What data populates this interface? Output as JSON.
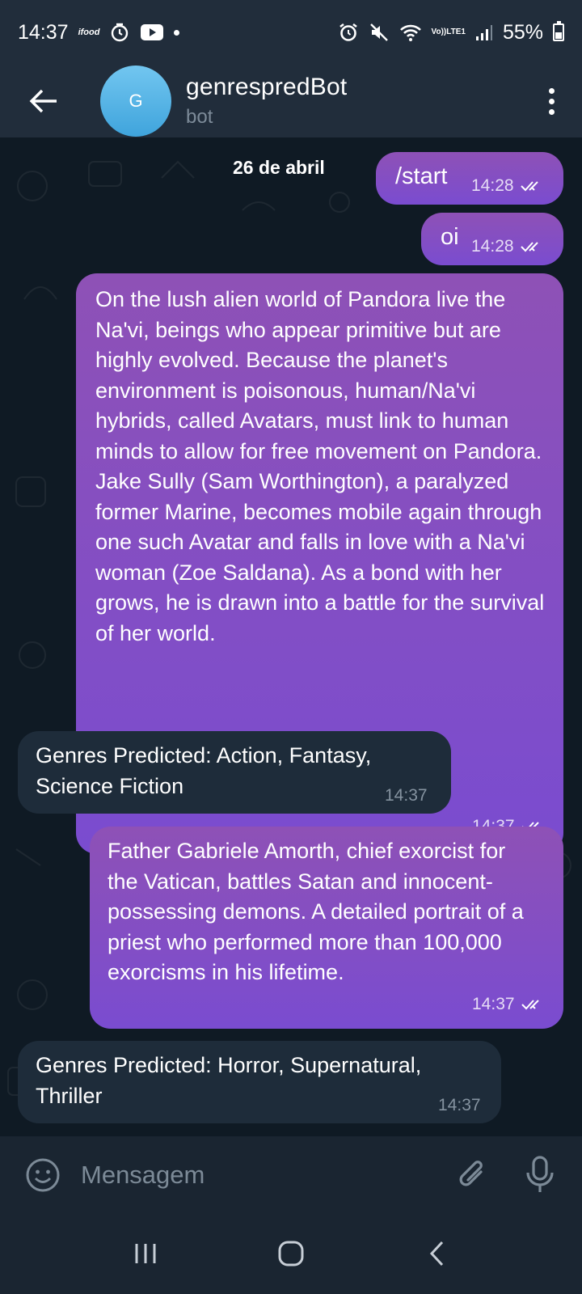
{
  "status_bar": {
    "time": "14:37",
    "ifood_label": "ifood",
    "volte_label": "Vo))",
    "lte_label": "LTE1",
    "battery": "55%",
    "icons": [
      "ifood-icon",
      "timer-icon",
      "youtube-icon",
      "notification-dot",
      "alarm-icon",
      "mute-icon",
      "wifi-icon",
      "volte-icon",
      "signal-icon",
      "battery-icon"
    ]
  },
  "header": {
    "avatar_letter": "G",
    "title": "genrespredBot",
    "subtitle": "bot",
    "avatar_color": "#4eaee3"
  },
  "chat": {
    "date": "26 de abril",
    "messages": [
      {
        "direction": "out",
        "text": "/start",
        "time": "14:28",
        "status": "read"
      },
      {
        "direction": "out",
        "text": "oi",
        "time": "14:28",
        "status": "read"
      },
      {
        "direction": "out",
        "text": "On the lush alien world of Pandora live the Na'vi, beings who appear primitive but are highly evolved. Because the planet's environment is poisonous, human/Na'vi hybrids, called Avatars, must link to human minds to allow for free movement on Pandora. Jake Sully (Sam Worthington), a paralyzed former Marine, becomes mobile again through one such Avatar and falls in love with a Na'vi woman (Zoe Saldana). As a bond with her grows, he is drawn into a battle for the survival of her world.",
        "time": "14:37",
        "status": "read"
      },
      {
        "direction": "in",
        "text": "Genres Predicted: Action, Fantasy, Science Fiction",
        "time": "14:37"
      },
      {
        "direction": "out",
        "text": "Father Gabriele Amorth, chief exorcist for the Vatican, battles Satan and innocent-possessing demons. A detailed portrait of a priest who performed more than 100,000 exorcisms in his lifetime.",
        "time": "14:37",
        "status": "read"
      },
      {
        "direction": "in",
        "text": "Genres Predicted: Horror, Supernatural, Thriller",
        "time": "14:37"
      }
    ]
  },
  "input": {
    "placeholder": "Mensagem"
  },
  "colors": {
    "outgoing_bubble": "#8e51b6",
    "outgoing_bubble_bottom": "#7a4cd0",
    "incoming_bubble": "#1e2c3a",
    "background": "#0f1a24",
    "header": "#212d3b"
  }
}
